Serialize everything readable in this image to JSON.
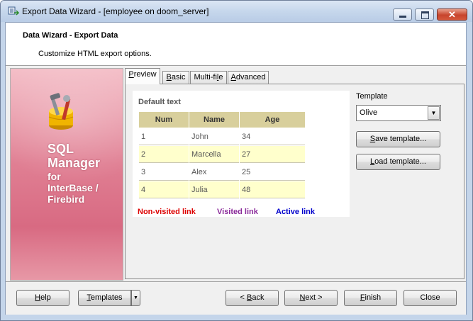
{
  "window": {
    "title": "Export Data Wizard - [employee on doom_server]",
    "controls": {
      "minimize": "",
      "maximize": "",
      "close": "✕"
    }
  },
  "header": {
    "title": "Data Wizard - Export Data",
    "subtitle": "Customize HTML export options."
  },
  "sidebar": {
    "brand_line1": "SQL",
    "brand_line2": "Manager",
    "brand_line3": "for",
    "brand_line4": "InterBase /",
    "brand_line5": "Firebird"
  },
  "tabs": [
    {
      "label_u": "P",
      "label_rest": "review",
      "active": true
    },
    {
      "label_u": "B",
      "label_rest": "asic",
      "active": false
    },
    {
      "label_pre": "Multi-fi",
      "label_u": "l",
      "label_rest": "e",
      "active": false
    },
    {
      "label_u": "A",
      "label_rest": "dvanced",
      "active": false
    }
  ],
  "preview": {
    "default_text": "Default text",
    "columns": [
      "Num",
      "Name",
      "Age"
    ],
    "rows": [
      [
        "1",
        "John",
        "34"
      ],
      [
        "2",
        "Marcella",
        "27"
      ],
      [
        "3",
        "Alex",
        "25"
      ],
      [
        "4",
        "Julia",
        "48"
      ]
    ],
    "links": {
      "non_visited": "Non-visited link",
      "visited": "Visited link",
      "active": "Active link"
    },
    "colors": {
      "header_bg": "#d8cf9c",
      "even_row_bg": "#ffffcc",
      "non_visited": "#dd0000",
      "visited": "#8a2a9a",
      "active": "#0000cc"
    }
  },
  "template": {
    "label": "Template",
    "selected": "Olive",
    "save_u": "S",
    "save_rest": "ave template...",
    "load_u": "L",
    "load_rest": "oad template..."
  },
  "footer": {
    "help_u": "H",
    "help_rest": "elp",
    "templates_u": "T",
    "templates_rest": "emplates",
    "back_pre": "< ",
    "back_u": "B",
    "back_rest": "ack",
    "next_u": "N",
    "next_rest": "ext >",
    "finish_u": "F",
    "finish_rest": "inish",
    "close": "Close"
  }
}
